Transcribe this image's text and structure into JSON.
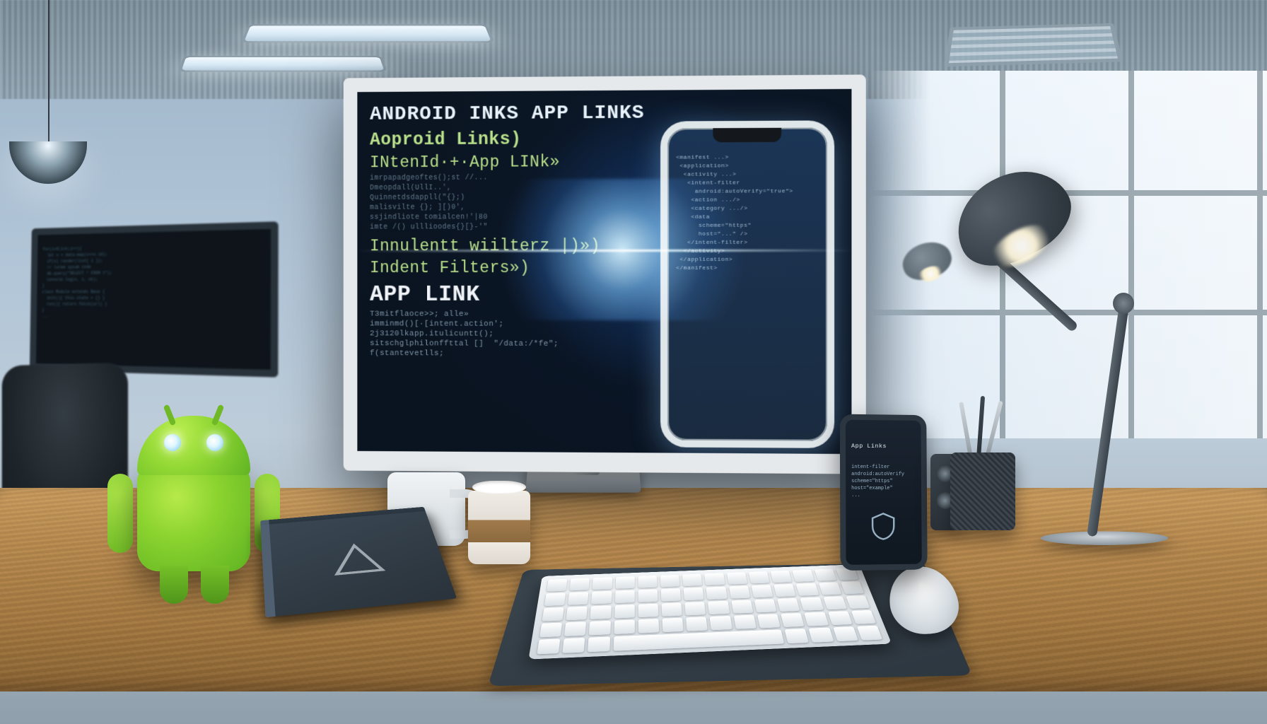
{
  "image": {
    "description": "Stylized 3D-rendered illustration of a modern open-plan software developer workspace. A wooden desk carries a large silver-bezel monitor whose dark IDE-style screen shows garbled/AI-generated pseudo-code headings about Android App Links and intent filters, with a smartphone mockup embedded on the right of the screen. On the desk: a green Android (bugdroid) figurine, a white ceramic mug, a paper coffee cup with brown sleeve, a notebook and a book with a triangle logo, a white low-profile keyboard on a dark deskpad, a white mouse, a small physical smartphone propped up, a small speaker, a mesh pen cup with pens, and a dark articulated desk lamp. Background: glass-walled industrial office with another monitor showing code, an office chair, ceiling fluorescent panels, a hanging pendant lamp, large grid window on the right letting light in, and an HVAC vent."
  },
  "monitor": {
    "line1": "ANDROID INKS APP LINKS",
    "line2": "Aoproid Links)",
    "line3": "INtenId·+·App LINk»",
    "line4": "Innulentt wiilterz |)»)",
    "line5": "Indent Filters»)",
    "line6": "APP LINK",
    "code1": "imrpapadgeoftes();st //...\\nDmeopdall(UllI..',\\nQuinnetdsdappll(\"{};)\\nmalisvilte {}; ][)0',\\nssjindliote tomialcen!'|80\\nimte /() ulllioodes{}[}-'\"",
    "code2": "T3mitflaoce>>; alle»\\nimminmd()[·[intent.action';\\n2j3120lkapp.itulicuntt();\\nsitschglphilonffttal []  \"/data:/*fe\";\\nf(stantevetlls;"
  },
  "phone_in_screen": {
    "code": "<manifest ...>\\n <application>\\n  <activity ...>\\n   <intent-filter\\n     android:autoVerify=\"true\">\\n    <action .../>\\n    <category .../>\\n    <data\\n      scheme=\"https\"\\n      host=\"...\" />\\n   </intent-filter>\\n  </activity>\\n </application>\\n</manifest>"
  },
  "desk_phone": {
    "title": "App Links",
    "body": "intent-filter\\nandroid:autoVerify\\nscheme=\"https\"\\nhost=\"example\"\\n..."
  },
  "desk_items": {
    "android_figurine": "android-bugdroid",
    "mug": "ceramic-mug",
    "cup": "paper-coffee-cup",
    "keyboard": "keyboard",
    "mouse": "mouse",
    "books": "book-stack",
    "lamp": "desk-lamp",
    "pen_holder": "pen-holder",
    "speaker": "mini-speaker"
  }
}
